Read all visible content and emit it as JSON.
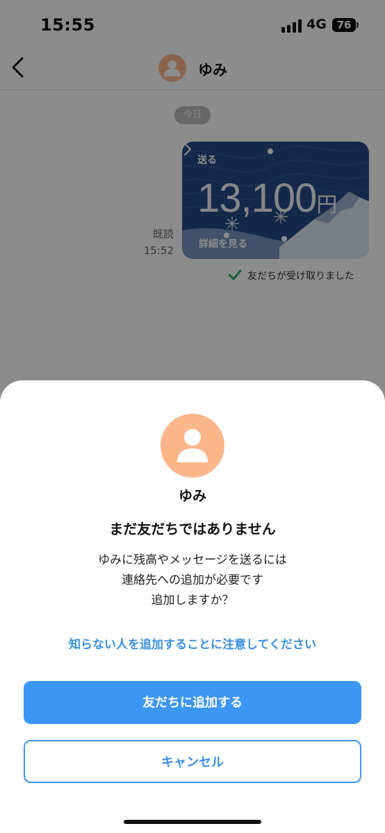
{
  "status_bar": {
    "time": "15:55",
    "network": "4G",
    "battery": "76"
  },
  "header": {
    "back_icon": "chevron-left-icon",
    "contact_name": "ゆみ",
    "avatar_icon": "person-icon"
  },
  "chat": {
    "date_label": "今日",
    "read_label": "既読",
    "read_time": "15:52",
    "card": {
      "send_label": "送る",
      "amount": "13,100",
      "currency": "円",
      "detail_label": "詳細を見る"
    },
    "received_status": "友だちが受け取りました"
  },
  "sheet": {
    "name": "ゆみ",
    "title": "まだ友だちではありません",
    "message_lines": [
      "ゆみに残高やメッセージを送るには",
      "連絡先への追加が必要です",
      "追加しますか？"
    ],
    "warning_link": "知らない人を追加することに注意してください",
    "add_button": "友だちに追加する",
    "cancel_button": "キャンセル"
  },
  "colors": {
    "accent": "#3c96f4",
    "link": "#3a8fe3",
    "avatar": "#f9b68b",
    "card_bg": "#264b86",
    "check": "#2fae5a"
  }
}
